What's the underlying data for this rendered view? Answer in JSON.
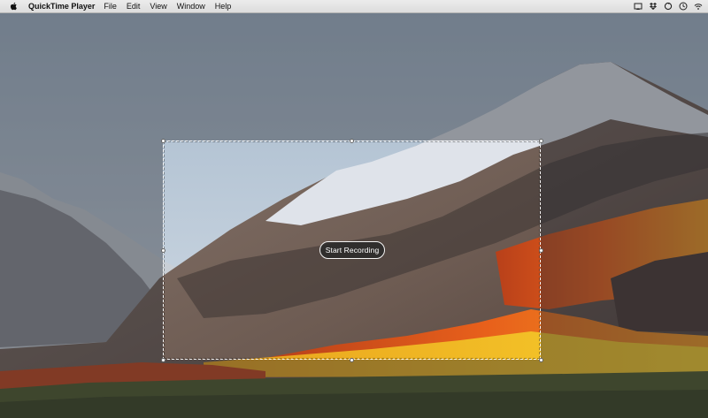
{
  "menubar": {
    "app_name": "QuickTime Player",
    "items": [
      "File",
      "Edit",
      "View",
      "Window",
      "Help"
    ],
    "status_icons": [
      "cast-icon",
      "dropbox-icon",
      "sync-icon",
      "clock-icon",
      "wifi-icon"
    ]
  },
  "capture": {
    "record_button_label": "Start Recording"
  },
  "colors": {
    "sky": "#4a4f57",
    "mountain_snow": "#dfe3ea",
    "foliage_orange": "#e5641c",
    "foliage_yellow": "#f2b81b"
  }
}
